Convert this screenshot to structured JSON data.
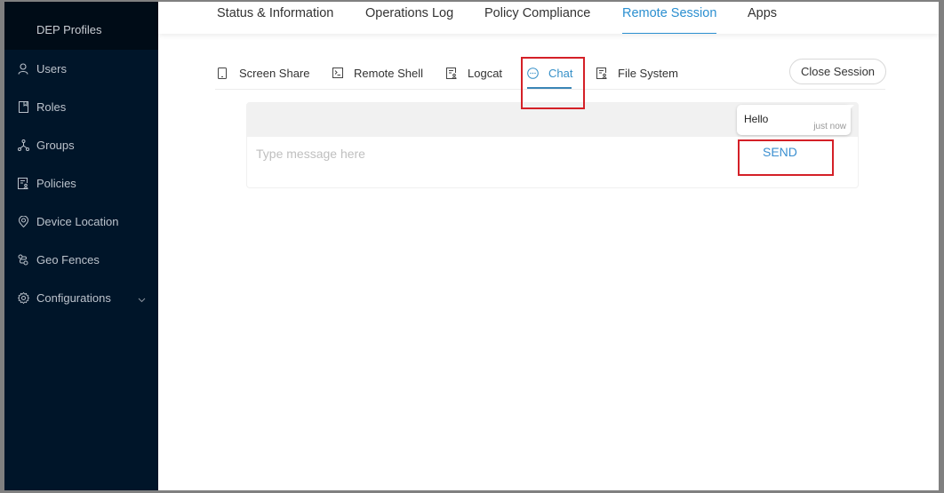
{
  "sidebar": {
    "top_item": "DEP Profiles",
    "items": [
      {
        "label": "Users",
        "icon": "user-icon"
      },
      {
        "label": "Roles",
        "icon": "book-icon"
      },
      {
        "label": "Groups",
        "icon": "cluster-icon"
      },
      {
        "label": "Policies",
        "icon": "policy-icon"
      },
      {
        "label": "Device Location",
        "icon": "location-icon"
      },
      {
        "label": "Geo Fences",
        "icon": "geofence-icon"
      },
      {
        "label": "Configurations",
        "icon": "gear-icon",
        "has_submenu": true
      }
    ]
  },
  "topnav": {
    "tabs": [
      {
        "label": "Status & Information"
      },
      {
        "label": "Operations Log"
      },
      {
        "label": "Policy Compliance"
      },
      {
        "label": "Remote Session",
        "active": true
      },
      {
        "label": "Apps"
      }
    ]
  },
  "subtabs": {
    "tabs": [
      {
        "label": "Screen Share",
        "icon": "mobile-icon"
      },
      {
        "label": "Remote Shell",
        "icon": "terminal-icon"
      },
      {
        "label": "Logcat",
        "icon": "file-icon"
      },
      {
        "label": "Chat",
        "icon": "message-icon",
        "active": true
      },
      {
        "label": "File System",
        "icon": "file-icon"
      }
    ],
    "close_label": "Close Session"
  },
  "chat": {
    "messages": [
      {
        "text": "Hello",
        "time": "just now"
      }
    ],
    "placeholder": "Type message here",
    "value": "",
    "send_label": "SEND"
  },
  "colors": {
    "accent": "#2b8fd0",
    "sidebar_bg": "#001529",
    "highlight": "#d42027"
  }
}
